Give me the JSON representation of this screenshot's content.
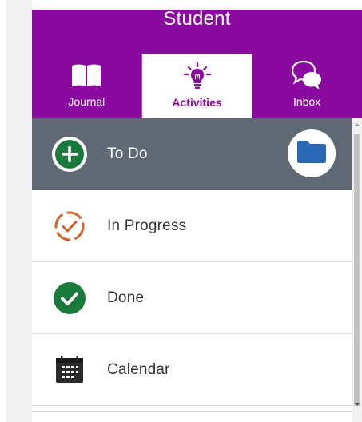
{
  "header": {
    "title": "Student"
  },
  "tabs": [
    {
      "label": "Journal",
      "icon": "book-icon",
      "active": false
    },
    {
      "label": "Activities",
      "icon": "lightbulb-icon",
      "active": true
    },
    {
      "label": "Inbox",
      "icon": "chat-bubbles-icon",
      "active": false
    }
  ],
  "list": {
    "items": [
      {
        "label": "To Do",
        "icon": "plus-circle-icon",
        "selected": true
      },
      {
        "label": "In Progress",
        "icon": "progress-check-icon",
        "selected": false
      },
      {
        "label": "Done",
        "icon": "check-circle-icon",
        "selected": false
      },
      {
        "label": "Calendar",
        "icon": "calendar-icon",
        "selected": false
      }
    ],
    "folder_icon": "folder-icon"
  },
  "colors": {
    "brand_purple": "#8a0a9f",
    "selected_row": "#606873",
    "todo_green": "#1a7a3c",
    "progress_orange": "#d0632a",
    "done_green": "#1a7a3c",
    "folder_blue": "#2a67b4",
    "calendar_dark": "#2b2b2b"
  }
}
